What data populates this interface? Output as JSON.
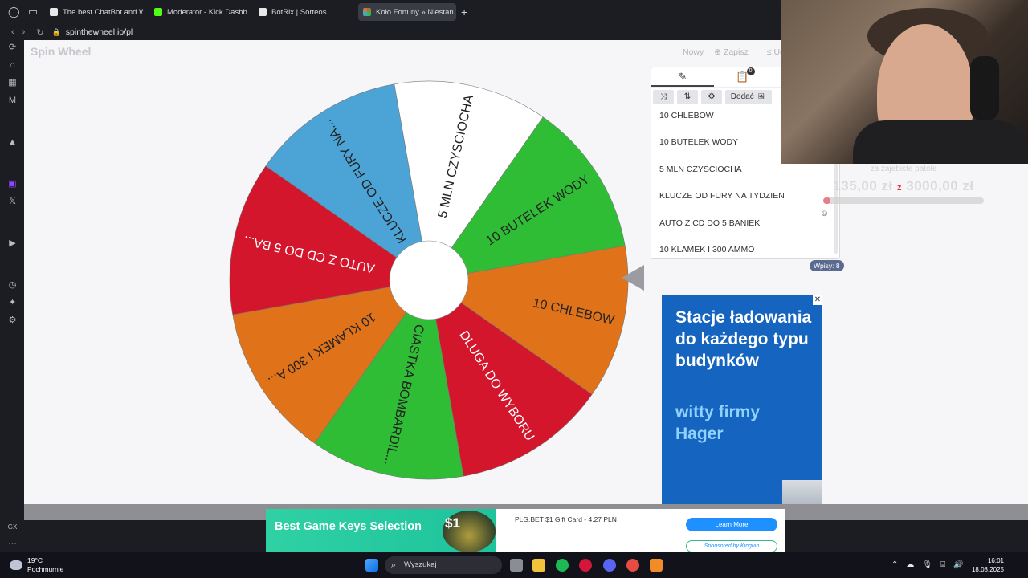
{
  "browser": {
    "tabs": [
      {
        "title": "The best ChatBot and Wi",
        "color": "#ffffff",
        "active": false
      },
      {
        "title": "Moderator - Kick Dashbo",
        "color": "#53fc18",
        "active": false
      },
      {
        "title": "BotRix | Sorteos",
        "color": "#ffffff",
        "active": false
      },
      {
        "title": "Koło Fortuny » Niestan",
        "color": "#e94b4b",
        "active": true
      }
    ],
    "new_tab": "+",
    "url": "spinthewheel.io/pl"
  },
  "app": {
    "logo": "Spin Wheel",
    "toolbar": [
      "Nowy",
      "Zapisz",
      "Ud"
    ]
  },
  "wheel": {
    "segments": [
      {
        "label": "10 CHLEBOW",
        "color": "#e07319",
        "text_color": "#222222"
      },
      {
        "label": "DLUGA DO WYBORU",
        "color": "#d4162d",
        "text_color": "#ffffff"
      },
      {
        "label": "CIASTKA BOMBARDIL...",
        "color": "#2fbd36",
        "text_color": "#222222"
      },
      {
        "label": "10 KLAMEK I 300 A...",
        "color": "#e07319",
        "text_color": "#222222"
      },
      {
        "label": "AUTO Z CD DO 5 BA...",
        "color": "#d4162d",
        "text_color": "#ffffff"
      },
      {
        "label": "KLUCZE OD FURY NA...",
        "color": "#4ba3d6",
        "text_color": "#222222"
      },
      {
        "label": "5 MLN CZYSCIOCHA",
        "color": "#ffffff",
        "text_color": "#222222"
      },
      {
        "label": "10 BUTELEK WODY",
        "color": "#2fbd36",
        "text_color": "#222222"
      }
    ]
  },
  "panel": {
    "tabs": [
      {
        "icon": "pencil-icon",
        "glyph": "✎",
        "badge": ""
      },
      {
        "icon": "clipboard-icon",
        "glyph": "📋",
        "badge": "0"
      },
      {
        "icon": "eye-off-icon",
        "glyph": "👁",
        "badge": ""
      }
    ],
    "actions": [
      {
        "name": "shuffle-button",
        "label": "⤨"
      },
      {
        "name": "sort-button",
        "label": "⇅"
      },
      {
        "name": "settings-button",
        "label": "⚙"
      },
      {
        "name": "add-image-button",
        "label": "Dodać 🖼"
      }
    ],
    "entries": [
      "10 CHLEBOW",
      "10 BUTELEK WODY",
      "5 MLN CZYSCIOCHA",
      "KLUCZE OD FURY NA TYDZIEN",
      "AUTO Z CD DO 5 BANIEK",
      "10 KLAMEK I 300 AMMO"
    ],
    "entry_count": "Wpisy: 8",
    "emoji": "☺"
  },
  "ad": {
    "headline": "Stacje ładowania do każdego typu budynków",
    "sub": "witty firmy Hager",
    "close": "✕"
  },
  "donation": {
    "title": "za zajebiste patole",
    "current": "135,00 zł",
    "separator": "z",
    "goal": "3000,00 zł",
    "progress": 0.045
  },
  "banner": {
    "title": "Best Game Keys Selection",
    "price": "$1",
    "text": "PLG.BET $1 Gift Card - 4.27 PLN",
    "button": "Learn More",
    "sponsor": "Sponsored by Kinguin"
  },
  "taskbar": {
    "temp": "19°C",
    "weather": "Pochmurnie",
    "search": "Wyszukaj",
    "time": "16:01",
    "date": "18.08.2025"
  }
}
